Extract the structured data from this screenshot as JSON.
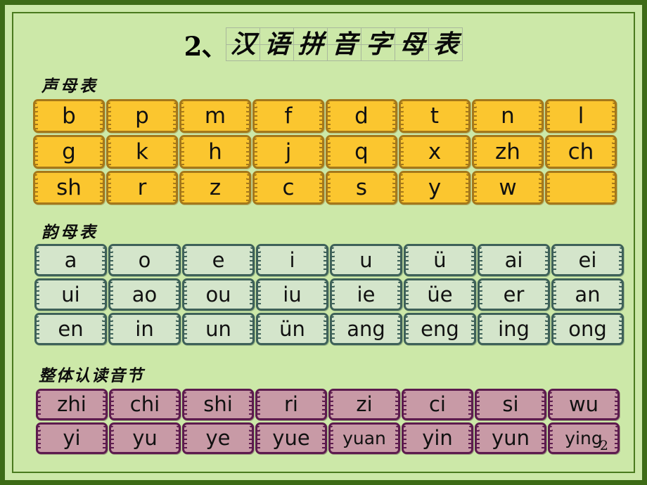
{
  "slide": {
    "page_number": "2",
    "background_color": "#cce8a8",
    "border_color": "#3d6b16"
  },
  "title": {
    "number": "2、",
    "text": "汉语拼音字母表",
    "characters": [
      "汉",
      "语",
      "拼",
      "音",
      "字",
      "母",
      "表"
    ]
  },
  "sections": [
    {
      "id": "shengmu",
      "label": "声母表",
      "fill_color": "#fbc62f",
      "border_color": "#a5781a",
      "rows": [
        [
          "b",
          "p",
          "m",
          "f",
          "d",
          "t",
          "n",
          "l"
        ],
        [
          "g",
          "k",
          "h",
          "j",
          "q",
          "x",
          "zh",
          "ch"
        ],
        [
          "sh",
          "r",
          "z",
          "c",
          "s",
          "y",
          "w",
          ""
        ]
      ]
    },
    {
      "id": "yunmu",
      "label": "韵母表",
      "fill_color": "#d4e5cb",
      "border_color": "#3e6159",
      "rows": [
        [
          "a",
          "o",
          "e",
          "i",
          "u",
          "ü",
          "ai",
          "ei"
        ],
        [
          "ui",
          "ao",
          "ou",
          "iu",
          "ie",
          "üe",
          "er",
          "an"
        ],
        [
          "en",
          "in",
          "un",
          "ün",
          "ang",
          "eng",
          "ing",
          "ong"
        ]
      ]
    },
    {
      "id": "zhengti",
      "label": "整体认读音节",
      "fill_color": "#c89aa6",
      "border_color": "#5d1b4e",
      "rows": [
        [
          "zhi",
          "chi",
          "shi",
          "ri",
          "zi",
          "ci",
          "si",
          "wu"
        ],
        [
          "yi",
          "yu",
          "ye",
          "yue",
          "yuan",
          "yin",
          "yun",
          "ying"
        ]
      ]
    }
  ]
}
